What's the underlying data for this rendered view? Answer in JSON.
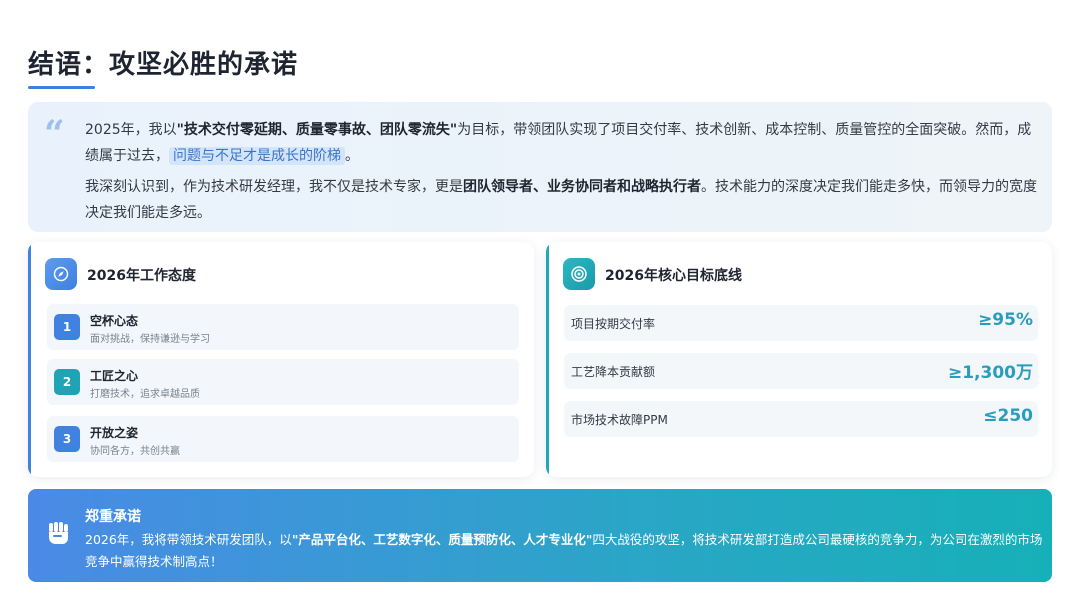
{
  "page": {
    "title": "结语：攻坚必胜的承诺"
  },
  "quote": {
    "mark": "66",
    "p1_before": "2025年，我以",
    "p1_bold": "\"技术交付零延期、质量零事故、团队零流失\"",
    "p1_after": "为目标，带领团队实现了项目交付率、技术创新、成本控制、质量管控的全面突破。然而，成绩属于过去，",
    "p1_highlight": "问题与不足才是成长的阶梯",
    "p1_end": "。",
    "p2_before": "我深刻认识到，作为技术研发经理，我不仅是技术专家，更是",
    "p2_bold": "团队领导者、业务协同者和战略执行者",
    "p2_after": "。技术能力的深度决定我们能走多快，而领导力的宽度决定我们能走多远。"
  },
  "attitude_card": {
    "title": "2026年工作态度",
    "icon": "compass-icon",
    "items": [
      {
        "num": "1",
        "name": "空杯心态",
        "desc": "面对挑战，保持谦逊与学习",
        "color": "#3f82e0"
      },
      {
        "num": "2",
        "name": "工匠之心",
        "desc": "打磨技术，追求卓越品质",
        "color": "#1fa3b5"
      },
      {
        "num": "3",
        "name": "开放之姿",
        "desc": "协同各方，共创共赢",
        "color": "#3f82e0"
      }
    ]
  },
  "goals_card": {
    "title": "2026年核心目标底线",
    "icon": "target-icon",
    "rows": [
      {
        "label": "项目按期交付率",
        "value": "≥95%"
      },
      {
        "label": "工艺降本贡献额",
        "value": "≥1,300万"
      },
      {
        "label": "市场技术故障PPM",
        "value": "≤250"
      }
    ]
  },
  "commitment": {
    "icon": "raised-fist-icon",
    "title": "郑重承诺",
    "text_before": "2026年，我将带领技术研发团队，以",
    "text_bold": "\"产品平台化、工艺数字化、质量预防化、人才专业化\"",
    "text_after": "四大战役的攻坚，将技术研发部打造成公司最硬核的竞争力，为公司在激烈的市场竞争中赢得技术制高点！"
  },
  "colors": {
    "accent_blue": "#3f82e0",
    "accent_teal": "#1fa8b8",
    "value_teal": "#2a9cbc"
  }
}
